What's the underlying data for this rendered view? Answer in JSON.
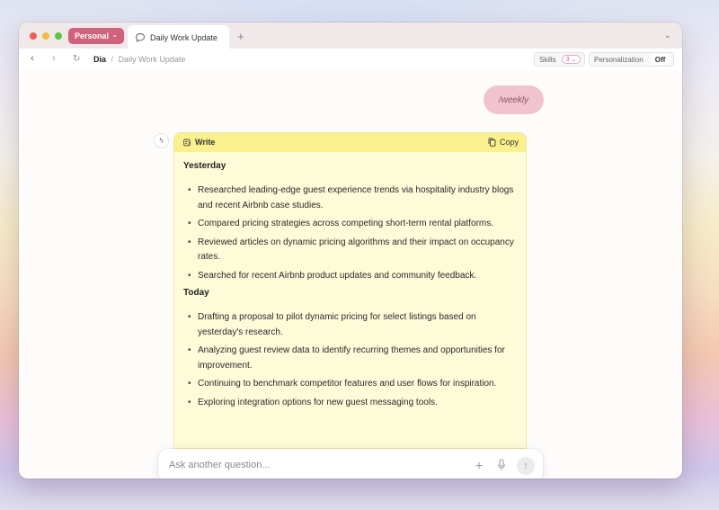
{
  "browser": {
    "profile_label": "Personal",
    "tab_title": "Daily Work Update",
    "new_tab": "+",
    "breadcrumb_root": "Dia",
    "breadcrumb_sep": "/",
    "breadcrumb_leaf": "Daily Work Update",
    "skills_label": "Skills",
    "skills_count": "3",
    "personalization_label": "Personalization",
    "personalization_state": "Off"
  },
  "chat": {
    "user_message": "/weekly",
    "write_label": "Write",
    "copy_label": "Copy",
    "sections": [
      {
        "title": "Yesterday",
        "items": [
          "Researched leading-edge guest experience trends via hospitality industry blogs and recent Airbnb case studies.",
          "Compared pricing strategies across competing short-term rental platforms.",
          "Reviewed articles on dynamic pricing algorithms and their impact on occupancy rates.",
          "Searched for recent Airbnb product updates and community feedback."
        ]
      },
      {
        "title": "Today",
        "items": [
          "Drafting a proposal to pilot dynamic pricing for select listings based on yesterday's research.",
          "Analyzing guest review data to identify recurring themes and opportunities for improvement.",
          "Continuing to benchmark competitor features and user flows for inspiration.",
          "Exploring integration options for new guest messaging tools."
        ]
      }
    ],
    "ask_placeholder": "Ask another question..."
  },
  "colors": {
    "profile_pill": "#d0637b",
    "user_bubble": "#f1c3cf",
    "write_header": "#fbf08e",
    "write_body": "#fefbd8"
  }
}
